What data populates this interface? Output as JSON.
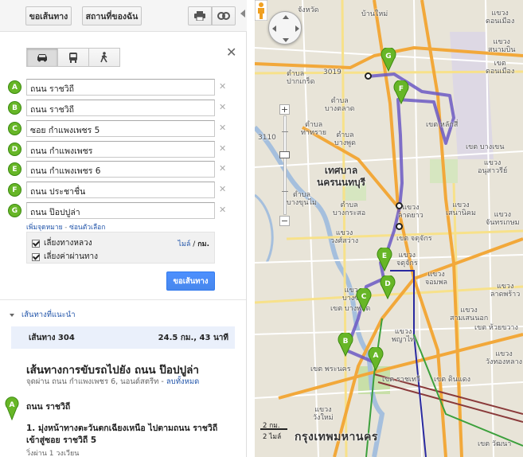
{
  "toolbar": {
    "directions_label": "ขอเส้นทาง",
    "my_places_label": "สถานที่ของฉัน",
    "print_icon": "printer-icon",
    "link_icon": "link-icon"
  },
  "travel_modes": [
    "car-icon",
    "transit-icon",
    "walk-icon"
  ],
  "waypoints": [
    {
      "letter": "A",
      "value": "ถนน ราชวิถี"
    },
    {
      "letter": "B",
      "value": "ถนน ราชวิถี"
    },
    {
      "letter": "C",
      "value": "ซอย กำแพงเพชร 5"
    },
    {
      "letter": "D",
      "value": "ถนน กำแพงเพชร"
    },
    {
      "letter": "E",
      "value": "ถนน กำแพงเพชร 6"
    },
    {
      "letter": "F",
      "value": "ถนน ประชาชื่น"
    },
    {
      "letter": "G",
      "value": "ถนน ป๊อปปูล่า"
    }
  ],
  "add_destination": "เพิ่มจุดหมาย",
  "hide_options": "ซ่อนตัวเลือก",
  "options": {
    "avoid_highways": "เลี่ยงทางหลวง",
    "avoid_tolls": "เลี่ยงค่าผ่านทาง",
    "unit_miles": "ไมล์",
    "unit_km": "กม."
  },
  "get_directions_button": "ขอเส้นทาง",
  "suggested_routes_header": "เส้นทางที่แนะนำ",
  "route": {
    "name": "เส้นทาง 304",
    "summary": "24.5 กม., 43 นาที"
  },
  "drive_title": "เส้นทางการขับรถไปยัง ถนน ป๊อปปูล่า",
  "via_text": "จุดผ่าน ถนน กำแพงเพชร 6, นอนด์สตรีท - ",
  "remove_all_link": "ลบทั้งหมด",
  "start": {
    "letter": "A",
    "label": "ถนน ราชวิถี"
  },
  "step_1": {
    "text": "1. มุ่งหน้าทางตะวันตกเฉียงเหนือ ไปตามถนน ราชวิถี เข้าสู่ซอย ราชวิถี 5",
    "sub": "วิ่งผ่าน 1 วงเวียน"
  },
  "map": {
    "labels": [
      {
        "t": "จังหวัด",
        "k": "n"
      },
      {
        "t": "บ้านใหม่",
        "k": "n"
      },
      {
        "t": "ตำบล",
        "k": "n"
      },
      {
        "t": "ปากเกร็ด",
        "k": "n"
      },
      {
        "t": "3019",
        "k": "road"
      },
      {
        "t": "ตำบล\nบางตลาด",
        "k": "n"
      },
      {
        "t": "ตำบล\nบางพูด",
        "k": "n"
      },
      {
        "t": "แขวง\nดอนเมือง",
        "k": "n"
      },
      {
        "t": "เขต\nดอนเมือง",
        "k": "n"
      },
      {
        "t": "แขวง\nสนามบิน",
        "k": "n"
      },
      {
        "t": "เขต หลักสี่",
        "k": "n"
      },
      {
        "t": "เขต บางเขน",
        "k": "n"
      },
      {
        "t": "แขวง\nอนุสาวรีย์",
        "k": "n"
      },
      {
        "t": "ตำบล\nท่าทราย",
        "k": "n"
      },
      {
        "t": "3110",
        "k": "road"
      },
      {
        "t": "เทศบาล\nนครนนทบุรี",
        "k": "city"
      },
      {
        "t": "ตำบล\nบางกระสอ",
        "k": "n"
      },
      {
        "t": "ตำบล\nบางขุนไม",
        "k": "n"
      },
      {
        "t": "แขวง\nลาดยาว",
        "k": "n"
      },
      {
        "t": "แขวง\nเสนานิคม",
        "k": "n"
      },
      {
        "t": "แขวง\nวงศ์สว่าง",
        "k": "n"
      },
      {
        "t": "เขต จตุจักร",
        "k": "n"
      },
      {
        "t": "แขวง\nจันทรเกษม",
        "k": "n"
      },
      {
        "t": "แขวง\nจตุจักร",
        "k": "n"
      },
      {
        "t": "แขวง\nจอมพล",
        "k": "n"
      },
      {
        "t": "แขวง\nบางซื่อ",
        "k": "n"
      },
      {
        "t": "เขต บางพลัด",
        "k": "n"
      },
      {
        "t": "แขวง\nลาดพร้าว",
        "k": "n"
      },
      {
        "t": "แขวง\nสามเสนนอก",
        "k": "n"
      },
      {
        "t": "เขต ห้วยขวาง",
        "k": "n"
      },
      {
        "t": "แขวง\nพญาไท",
        "k": "n"
      },
      {
        "t": "เขต พระนคร",
        "k": "n"
      },
      {
        "t": "เขต ราชเทวี",
        "k": "n"
      },
      {
        "t": "เขต ดินแดง",
        "k": "n"
      },
      {
        "t": "แขวง\nวังทองหลาง",
        "k": "n"
      },
      {
        "t": "กรุงเทพมหานคร",
        "k": "big"
      },
      {
        "t": "แขวง\nวังใหม่",
        "k": "n"
      },
      {
        "t": "เขต วัฒนา",
        "k": "n"
      }
    ],
    "scale_km": "2 กม.",
    "scale_mi": "2 ไมล์",
    "colors": {
      "route": "#6b59c4",
      "highway": "#f2a83a",
      "pin": "#67b627"
    }
  }
}
